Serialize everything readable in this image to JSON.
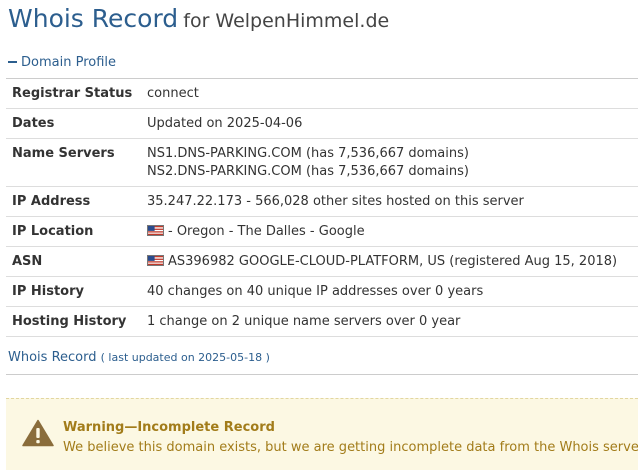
{
  "header": {
    "title_main": "Whois Record",
    "title_for": "for WelpenHimmel.de"
  },
  "profile": {
    "section_label": "Domain Profile",
    "rows": [
      {
        "label": "Registrar Status",
        "value": "connect"
      },
      {
        "label": "Dates",
        "value": "Updated on 2025-04-06"
      },
      {
        "label": "Name Servers",
        "value": "NS1.DNS-PARKING.COM (has 7,536,667 domains)",
        "value2": "NS2.DNS-PARKING.COM (has 7,536,667 domains)"
      },
      {
        "label": "IP Address",
        "value": "35.247.22.173 - 566,028 other sites hosted on this server"
      },
      {
        "label": "IP Location",
        "value": "- Oregon - The Dalles - Google"
      },
      {
        "label": "ASN",
        "value": "AS396982 GOOGLE-CLOUD-PLATFORM, US (registered Aug 15, 2018)"
      },
      {
        "label": "IP History",
        "value": "40 changes on 40 unique IP addresses over 0 years"
      },
      {
        "label": "Hosting History",
        "value": "1 change on 2 unique name servers over 0 year"
      }
    ]
  },
  "whois": {
    "label": "Whois Record",
    "updated": "( last updated on 2025-05-18 )"
  },
  "warning": {
    "title": "Warning—Incomplete Record",
    "text": "We believe this domain exists, but we are getting incomplete data from the Whois server."
  },
  "icons": {
    "flag": "us-flag-icon",
    "collapse": "minus-icon",
    "warning": "warning-triangle-icon"
  },
  "colors": {
    "accent": "#2c5e8e",
    "warning_bg": "#fcf8e3",
    "warning_text": "#a27c1a",
    "warning_icon": "#8a6d3b"
  }
}
